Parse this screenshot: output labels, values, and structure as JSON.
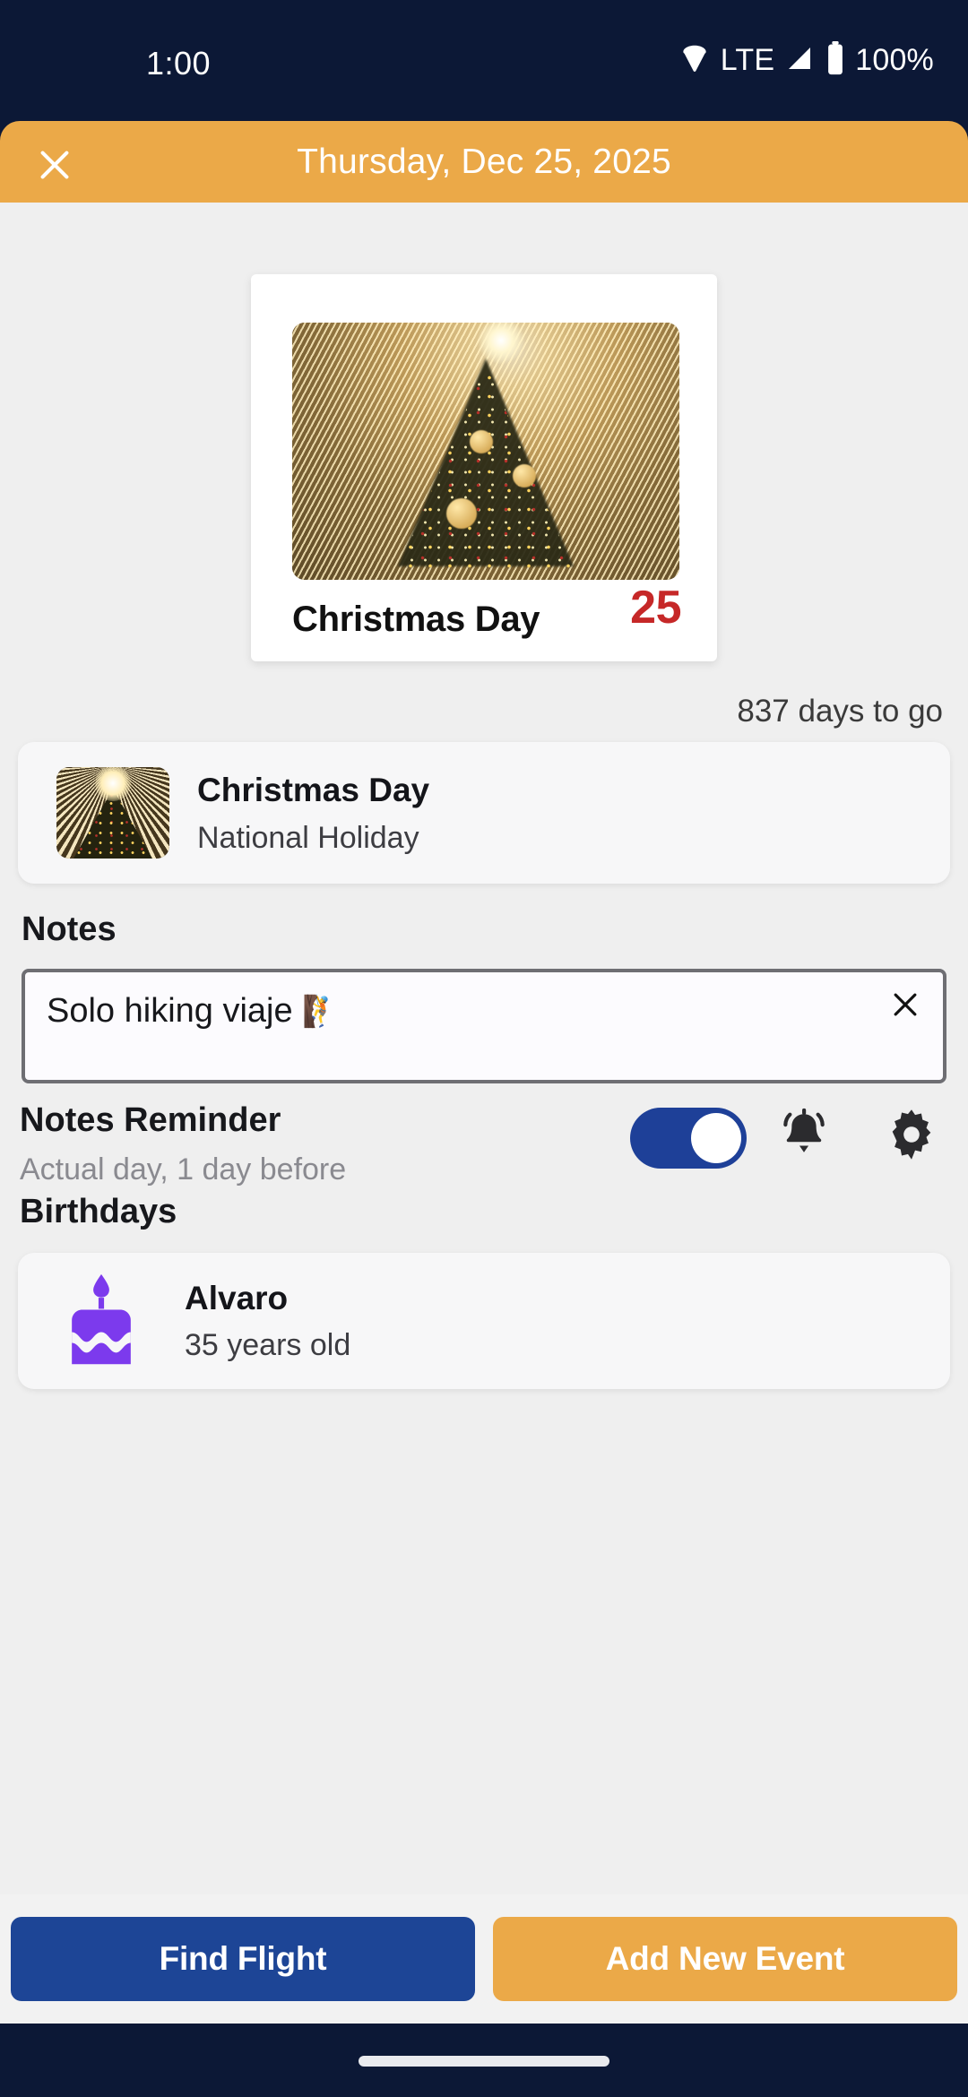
{
  "status_bar": {
    "time": "1:00",
    "network_label": "LTE",
    "battery_percent": "100%",
    "icons": [
      "wifi-icon",
      "signal-icon",
      "battery-icon"
    ],
    "background_color": "#0C1836"
  },
  "header": {
    "close_icon": "close-icon",
    "title": "Thursday, Dec 25, 2025",
    "background_color": "#EBA948"
  },
  "hero": {
    "image_alt": "christmas-tree-photo",
    "event_name": "Christmas Day",
    "day_number": "25",
    "day_number_color": "#C62828",
    "countdown": "837 days to go"
  },
  "holiday_item": {
    "thumbnail_alt": "christmas-tree-thumbnail",
    "title": "Christmas Day",
    "subtitle": "National Holiday"
  },
  "notes": {
    "section_label": "Notes",
    "value": "Solo hiking viaje",
    "emoji": "🧗",
    "placeholder": "Notes",
    "clear_icon": "close-icon"
  },
  "notes_reminder": {
    "title": "Notes Reminder",
    "subtitle": "Actual day, 1 day before",
    "toggle_state": "on",
    "toggle_color": "#1E4098",
    "bell_icon": "bell-ringing-icon",
    "gear_icon": "gear-icon"
  },
  "birthdays": {
    "section_label": "Birthdays",
    "items": [
      {
        "icon": "birthday-cake-icon",
        "icon_color": "#7C3AED",
        "name": "Alvaro",
        "age": "35 years old"
      }
    ]
  },
  "bottom_bar": {
    "primary_button": "Find Flight",
    "primary_color": "#1D4596",
    "secondary_button": "Add New Event",
    "secondary_color": "#EBA948"
  },
  "nav_bar": {
    "gesture_pill": "home-gesture-pill"
  }
}
